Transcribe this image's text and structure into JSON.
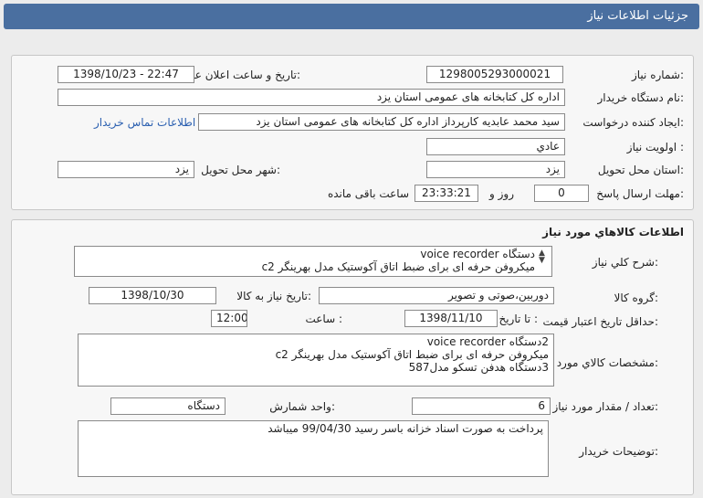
{
  "header": {
    "title": "جزئيات اطلاعات نياز"
  },
  "need": {
    "number_label": "شماره نياز:",
    "number": "1298005293000021",
    "announce_label": "تاريخ و ساعت اعلان عمومی:",
    "announce": "1398/10/23 - 22:47",
    "buyer_label": "نام دستگاه خريدار:",
    "buyer": "اداره کل کتابخانه های عمومی استان یزد",
    "creator_label": "ايجاد کننده درخواست:",
    "creator": "سید محمد عابدیه کارپرداز اداره کل کتابخانه های عمومی استان یزد",
    "contact_link": "اطلاعات تماس خريدار",
    "priority_label": "اولويت نياز :",
    "priority": "عادي",
    "province_label": "استان محل تحويل:",
    "province": "یزد",
    "city_label": "شهر محل تحويل:",
    "city": "یزد",
    "deadline_label": "مهلت ارسال پاسخ:",
    "days": "0",
    "days_unit": "روز و",
    "time": "23:33:21",
    "remaining": "ساعت باقی مانده"
  },
  "goods": {
    "title": "اطلاعات کالاهاي مورد نياز",
    "desc_label": "شرح کلي نياز:",
    "desc": "دستگاه  voice  recorder\nمیکروفن حرفه ای برای ضبط اتاق آکوستیک مدل بهرینگر c2",
    "group_label": "گروه کالا:",
    "group": "دوربین،صوتی و تصویر",
    "need_date_label": "تاريخ نياز به کالا:",
    "need_date": "1398/10/30",
    "min_price_label": "حداقل تاريخ اعتبار قيمت:",
    "until_label": "تا تاريخ :",
    "until_date": "1398/11/10",
    "time_label": "ساعت :",
    "time": "12:00",
    "spec_label": "مشخصات کالاي مورد نياز:",
    "spec": "2دستگاه  voice  recorder\nمیکروفن حرفه ای برای ضبط اتاق آکوستیک مدل بهرینگر c2\n3دستگاه هدفن تسکو مدل587",
    "qty_label": "تعداد / مقدار مورد نياز:",
    "qty": "6",
    "unit_label": "واحد شمارش:",
    "unit": "دستگاه",
    "notes_label": "توضيحات خريدار:",
    "notes": "پرداخت به صورت اسناد خزانه باسر رسید 99/04/30 میباشد"
  }
}
